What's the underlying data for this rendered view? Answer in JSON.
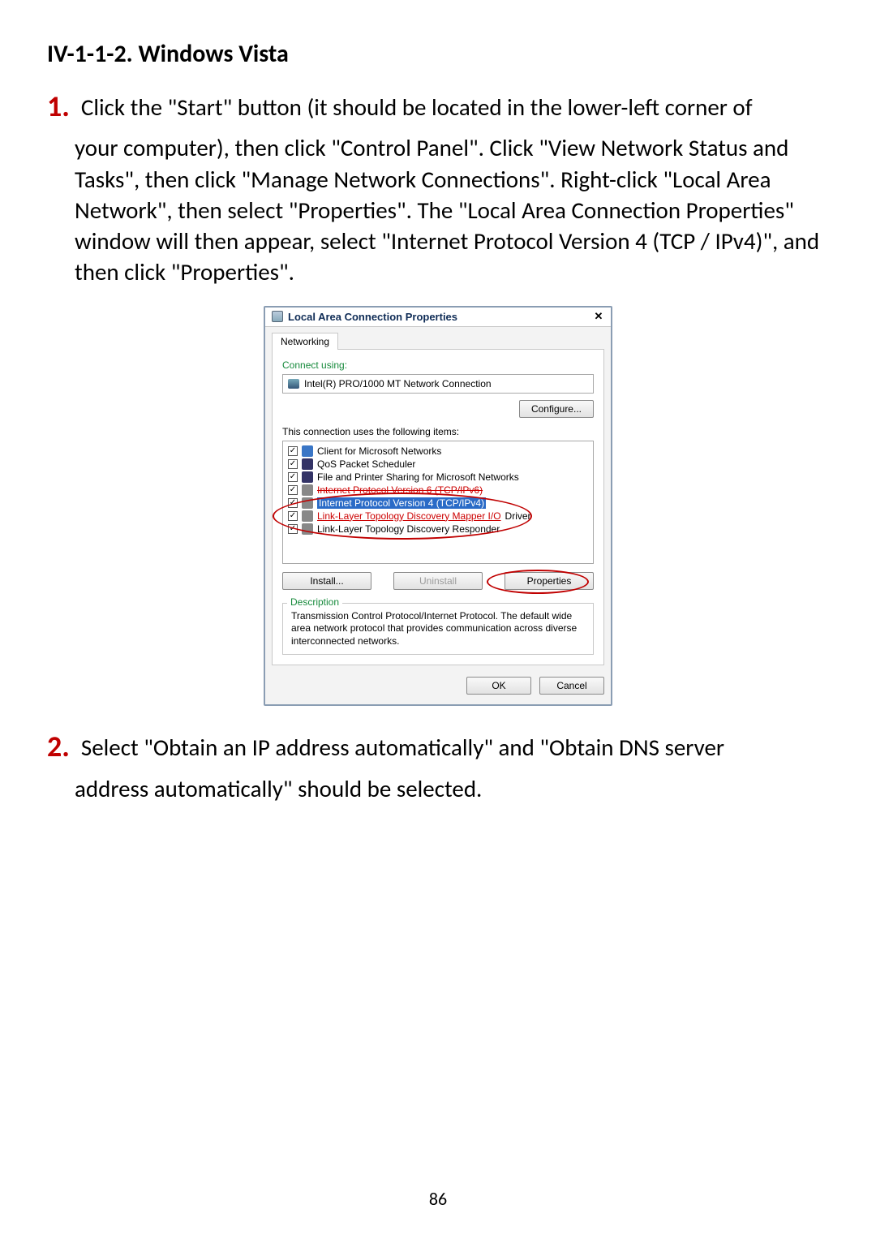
{
  "heading": "IV-1-1-2.   Windows Vista",
  "step1": {
    "num": "1.",
    "text1": "  Click the \"Start\" button (it should be located in the lower-left corner of",
    "text2": "your computer), then click \"Control Panel\". Click \"View Network Status and Tasks\", then click \"Manage Network Connections\". Right-click \"Local Area Network\", then select \"Properties\". The \"Local Area Connection Properties\" window will then appear, select \"Internet Protocol Version 4 (TCP / IPv4)\", and then click \"Properties\"."
  },
  "step2": {
    "num": "2.",
    "text1": "  Select \"Obtain an IP address automatically\" and \"Obtain DNS server",
    "text2": "address automatically\" should be selected."
  },
  "dialog": {
    "title": "Local Area Connection Properties",
    "tab": "Networking",
    "connect_label": "Connect using:",
    "adapter": "Intel(R) PRO/1000 MT Network Connection",
    "configure_btn": "Configure...",
    "items_label": "This connection uses the following items:",
    "items": [
      "Client for Microsoft Networks",
      "QoS Packet Scheduler",
      "File and Printer Sharing for Microsoft Networks",
      "Internet Protocol Version 6 (TCP/IPv6)",
      "Internet Protocol Version 4 (TCP/IPv4)",
      "Link-Layer Topology Discovery Mapper I/O Driver",
      "Link-Layer Topology Discovery Responder"
    ],
    "install_btn": "Install...",
    "uninstall_btn": "Uninstall",
    "properties_btn": "Properties",
    "desc_label": "Description",
    "desc_text": "Transmission Control Protocol/Internet Protocol. The default wide area network protocol that provides communication across diverse interconnected networks.",
    "ok_btn": "OK",
    "cancel_btn": "Cancel"
  },
  "page_number": "86"
}
